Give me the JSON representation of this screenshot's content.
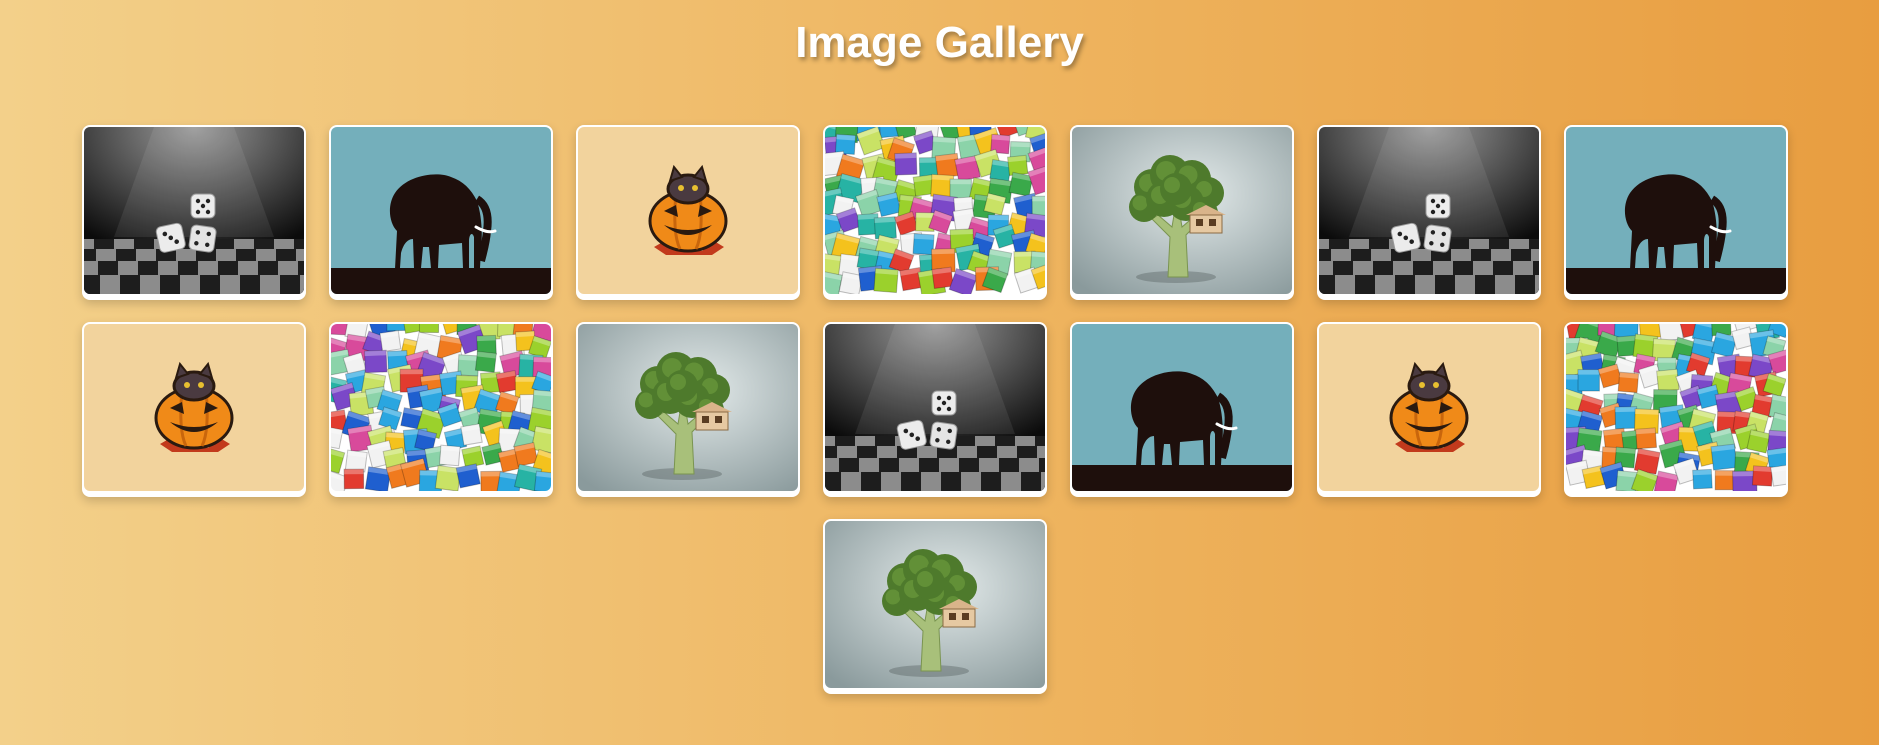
{
  "page": {
    "title": "Image Gallery"
  },
  "gallery": {
    "items": [
      {
        "icon": "dice-icon"
      },
      {
        "icon": "elephant-icon"
      },
      {
        "icon": "pumpkin-cat-icon"
      },
      {
        "icon": "colored-cubes-icon"
      },
      {
        "icon": "broccoli-treehouse-icon"
      },
      {
        "icon": "dice-icon"
      },
      {
        "icon": "elephant-icon"
      },
      {
        "icon": "pumpkin-cat-icon"
      },
      {
        "icon": "colored-cubes-icon"
      },
      {
        "icon": "broccoli-treehouse-icon"
      },
      {
        "icon": "dice-icon"
      },
      {
        "icon": "elephant-icon"
      },
      {
        "icon": "pumpkin-cat-icon"
      },
      {
        "icon": "colored-cubes-icon"
      },
      {
        "icon": "broccoli-treehouse-icon"
      }
    ]
  },
  "colors": {
    "background_start": "#f3d08a",
    "background_end": "#e89d40",
    "elephant_sky": "#74afbb",
    "pumpkin_bg": "#f2d39d",
    "title": "#ffffff"
  }
}
